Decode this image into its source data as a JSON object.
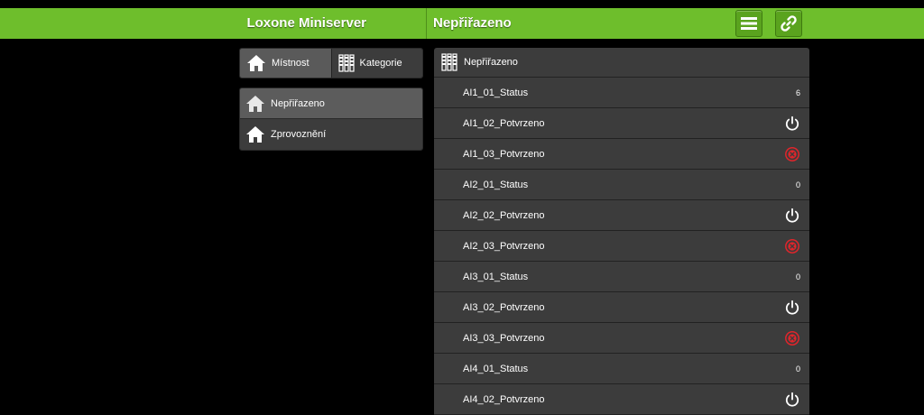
{
  "header": {
    "app_title": "Loxone Miniserver",
    "page_title": "Nepřiřazeno"
  },
  "colors": {
    "accent": "#6ebe2c",
    "panel": "#3c3c3c",
    "active": "#5c5c5c",
    "error": "#e0252b"
  },
  "segments": [
    {
      "label": "Místnost",
      "icon": "house-icon",
      "active": true
    },
    {
      "label": "Kategorie",
      "icon": "category-icon",
      "active": false
    }
  ],
  "rooms": [
    {
      "label": "Nepřiřazeno",
      "icon": "house-icon",
      "active": true
    },
    {
      "label": "Zprovoznění",
      "icon": "house-icon",
      "active": false
    }
  ],
  "list": {
    "header_label": "Nepřiřazeno",
    "header_icon": "category-icon",
    "rows": [
      {
        "label": "AI1_01_Status",
        "type": "value",
        "value": "6"
      },
      {
        "label": "AI1_02_Potvrzeno",
        "type": "power",
        "icon": "power-icon"
      },
      {
        "label": "AI1_03_Potvrzeno",
        "type": "error",
        "icon": "error-icon"
      },
      {
        "label": "AI2_01_Status",
        "type": "value",
        "value": "0"
      },
      {
        "label": "AI2_02_Potvrzeno",
        "type": "power",
        "icon": "power-icon"
      },
      {
        "label": "AI2_03_Potvrzeno",
        "type": "error",
        "icon": "error-icon"
      },
      {
        "label": "AI3_01_Status",
        "type": "value",
        "value": "0"
      },
      {
        "label": "AI3_02_Potvrzeno",
        "type": "power",
        "icon": "power-icon"
      },
      {
        "label": "AI3_03_Potvrzeno",
        "type": "error",
        "icon": "error-icon"
      },
      {
        "label": "AI4_01_Status",
        "type": "value",
        "value": "0"
      },
      {
        "label": "AI4_02_Potvrzeno",
        "type": "power",
        "icon": "power-icon"
      }
    ]
  }
}
